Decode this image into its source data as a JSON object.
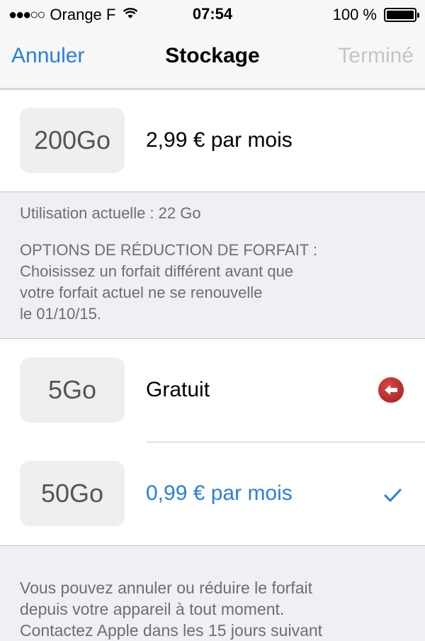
{
  "status_bar": {
    "signal": "●●●○○",
    "carrier": "Orange F",
    "time": "07:54",
    "battery_text": "100 %",
    "battery_level": 1.0
  },
  "nav": {
    "cancel": "Annuler",
    "title": "Stockage",
    "done": "Terminé"
  },
  "current_plan": {
    "size": "200Go",
    "price": "2,99 € par mois"
  },
  "info": {
    "usage": "Utilisation actuelle : 22 Go",
    "downgrade_lines": [
      "OPTIONS DE RÉDUCTION DE FORFAIT :",
      "Choisissez un forfait différent avant que",
      "votre forfait actuel ne se renouvelle",
      "le 01/10/15."
    ]
  },
  "plans": [
    {
      "size": "5Go",
      "price": "Gratuit",
      "selected": false
    },
    {
      "size": "50Go",
      "price": "0,99 € par mois",
      "selected": true
    }
  ],
  "footer_lines": [
    "Vous pouvez annuler ou réduire le forfait",
    "depuis votre appareil à tout moment.",
    "Contactez Apple dans les 15 jours suivant"
  ],
  "colors": {
    "accent": "#2a7ee0",
    "disabled": "#c4c4c9",
    "delete": "#b52525"
  }
}
